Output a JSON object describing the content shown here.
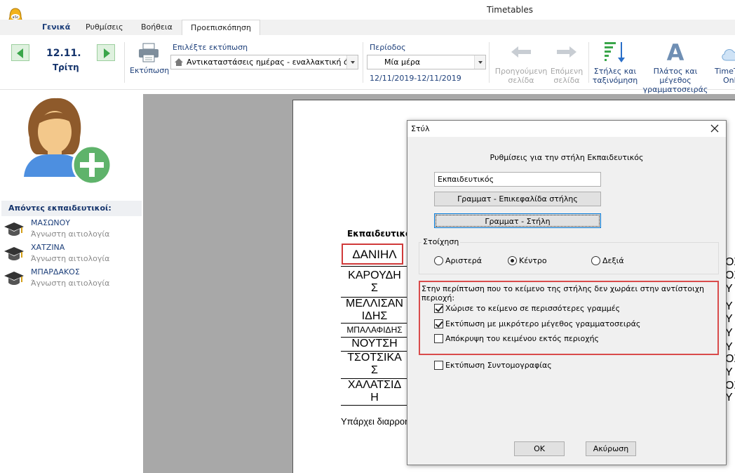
{
  "window": {
    "title": "Timetables"
  },
  "tabs": [
    {
      "label": "Γενικά"
    },
    {
      "label": "Ρυθμίσεις"
    },
    {
      "label": "Βοήθεια"
    },
    {
      "label": "Προεπισκόπηση"
    }
  ],
  "ribbon": {
    "date": "12.11.",
    "day": "Τρίτη",
    "print_label": "Εκτύπωση",
    "select_print_label": "Επιλέξτε εκτύπωση",
    "select_print_value": "Αντικαταστάσεις ημέρας - εναλλακτική όψη",
    "period_label": "Περίοδος",
    "period_value": "Μία μέρα",
    "period_range": "12/11/2019-12/11/2019",
    "prev_page_line1": "Προηγούμενη",
    "prev_page_line2": "σελίδα",
    "next_page_line1": "Επόμενη",
    "next_page_line2": "σελίδα",
    "columns_line1": "Στήλες και",
    "columns_line2": "ταξινόμηση",
    "font_line1": "Πλάτος και μέγεθος",
    "font_line2": "γραμματοσειράς",
    "online_line1": "TimeTa",
    "online_line2": "Onl"
  },
  "absent": {
    "header": "Απόντες εκπαιδευτικοί:",
    "items": [
      {
        "name": "ΜΑΣΩΝΟΥ",
        "reason": "Άγνωστη αιτιολογία"
      },
      {
        "name": "ΧΑΤΖΙΝΑ",
        "reason": "Άγνωστη αιτιολογία"
      },
      {
        "name": "ΜΠΑΡΔΑΚΟΣ",
        "reason": "Άγνωστη αιτιολογία"
      }
    ]
  },
  "preview": {
    "column_header": "Εκπαιδευτικός",
    "cells": [
      {
        "line1": "ΔΑΝΙΗΛ",
        "line2": ""
      },
      {
        "line1": "ΚΑΡΟΥΔΗ",
        "line2": "Σ"
      },
      {
        "line1": "ΜΕΛΛΙΣΑΝ",
        "line2": "ΙΔΗΣ"
      },
      {
        "line1": "ΜΠΑΛΑΦΙΔΗΣ",
        "line2": ""
      },
      {
        "line1": "ΝΟΥΤΣΗ",
        "line2": ""
      },
      {
        "line1": "ΤΣΟΤΣΙΚΑ",
        "line2": "Σ"
      },
      {
        "line1": "ΧΑΛΑΤΣΙΔ",
        "line2": "Η"
      }
    ],
    "footnote": "Υπάρχει διαρροή",
    "right_chars": [
      "ΟΣ",
      "ΟΣ",
      "Υ",
      "Υ",
      "Υ",
      "Υ",
      "Υ",
      "ΟΣ",
      "Υ",
      "ΟΣ",
      "Υ"
    ]
  },
  "dialog": {
    "title": "Στύλ",
    "subtitle": "Ρυθμίσεις για την στήλη Εκπαιδευτικός",
    "column_name": "Εκπαιδευτικός",
    "btn_font_header": "Γραμματ - Επικεφαλίδα στήλης",
    "btn_font_column": "Γραμματ - Στήλη",
    "align_group_label": "Στοίχηση",
    "align_left": "Αριστερά",
    "align_center": "Κέντρο",
    "align_right": "Δεξιά",
    "align_selected": "Κέντρο",
    "overflow_label": "Στην περίπτωση που το κείμενο της στήλης δεν χωράει στην αντίστοιχη περιοχή:",
    "opt_wrap": "Χώρισε το κείμενο σε περισσότερες γραμμές",
    "opt_wrap_checked": true,
    "opt_smaller": "Εκτύπωση με μικρότερο μέγεθος γραμματοσειράς",
    "opt_smaller_checked": true,
    "opt_hide": "Απόκρυψη του κειμένου εκτός περιοχής",
    "opt_hide_checked": false,
    "opt_short": "Εκτύπωση Συντομογραφίας",
    "opt_short_checked": false,
    "ok": "OK",
    "cancel": "Ακύρωση"
  }
}
